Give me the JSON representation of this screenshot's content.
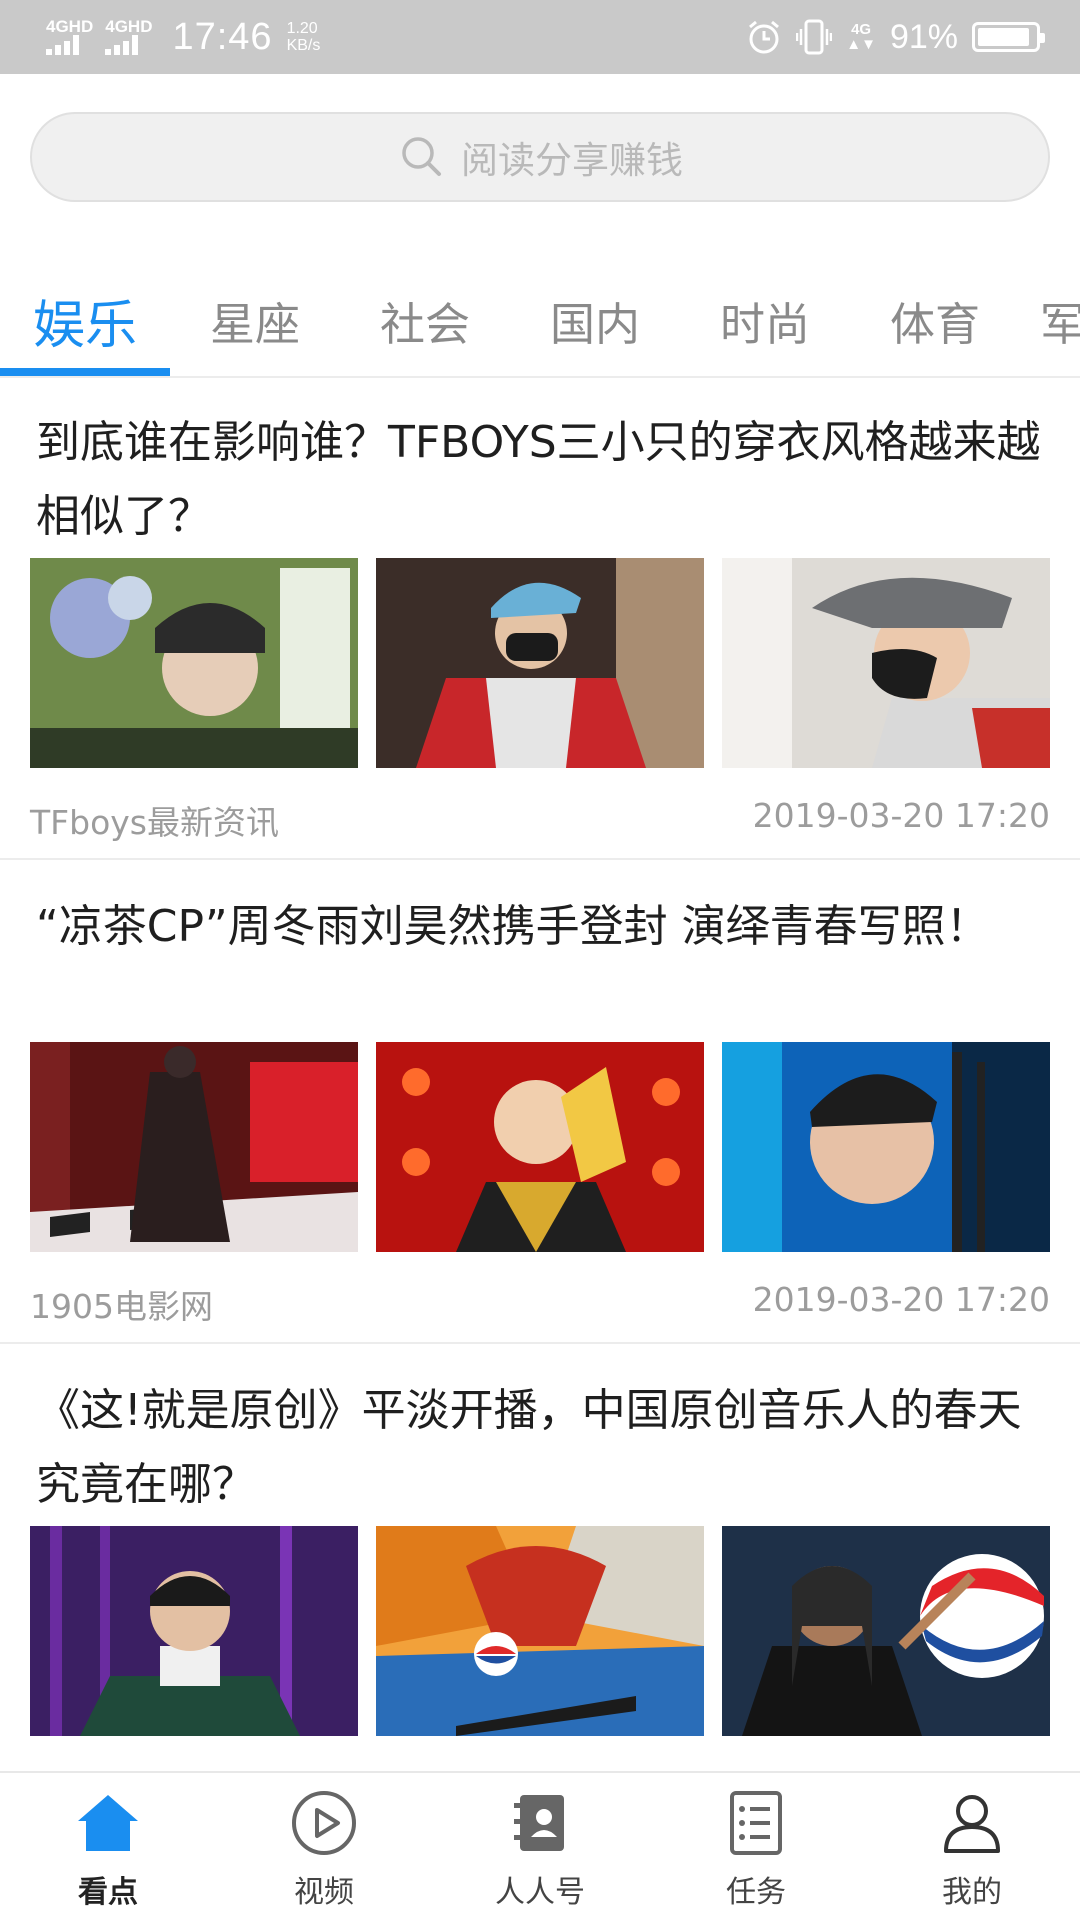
{
  "status_bar": {
    "signal_1": "4GHD",
    "signal_2": "4GHD",
    "time": "17:46",
    "net_speed_value": "1.20",
    "net_speed_unit": "KB/s",
    "alarm_icon": "alarm-icon",
    "vibrate_icon": "vibrate-icon",
    "network_small": "4G",
    "battery_percent_text": "91%",
    "battery_level": 0.91
  },
  "search": {
    "placeholder": "阅读分享赚钱"
  },
  "tabs": [
    {
      "label": "娱乐",
      "active": true
    },
    {
      "label": "星座",
      "active": false
    },
    {
      "label": "社会",
      "active": false
    },
    {
      "label": "国内",
      "active": false
    },
    {
      "label": "时尚",
      "active": false
    },
    {
      "label": "体育",
      "active": false
    },
    {
      "label": "军",
      "active": false
    }
  ],
  "news": [
    {
      "title": "到底谁在影响谁？TFBOYS三小只的穿衣风格越来越相似了？",
      "source": "TFboys最新资讯",
      "time": "2019-03-20 17:20"
    },
    {
      "title": "“凉茶CP”周冬雨刘昊然携手登封 演绎青春写照！",
      "source": "1905电影网",
      "time": "2019-03-20 17:20"
    },
    {
      "title": "《这!就是原创》平淡开播，中国原创音乐人的春天究竟在哪？",
      "source": "",
      "time": ""
    }
  ],
  "bottom_nav": [
    {
      "label": "看点",
      "icon": "home-icon",
      "active": true
    },
    {
      "label": "视频",
      "icon": "video-play-icon",
      "active": false
    },
    {
      "label": "人人号",
      "icon": "contacts-book-icon",
      "active": false
    },
    {
      "label": "任务",
      "icon": "task-list-icon",
      "active": false
    },
    {
      "label": "我的",
      "icon": "profile-icon",
      "active": false
    }
  ],
  "colors": {
    "accent": "#1a8ef0",
    "status_bar": "#c9c9c9"
  }
}
